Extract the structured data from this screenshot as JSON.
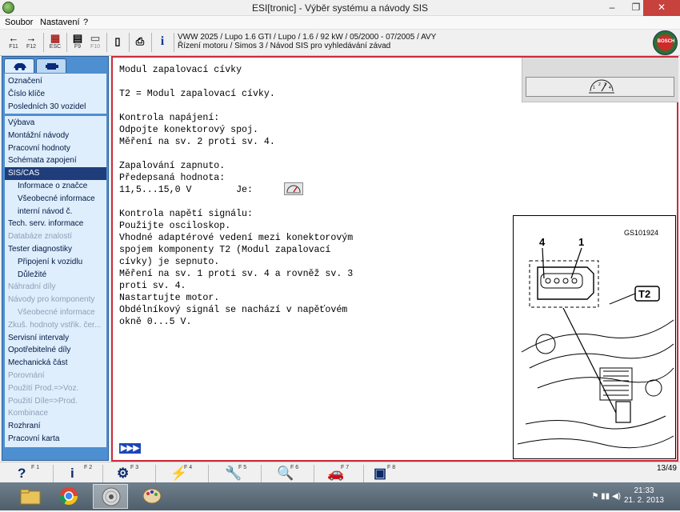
{
  "window": {
    "title": "ESI[tronic] - Výběr systému a návody SIS",
    "controls": {
      "minimize": "–",
      "maximize": "❐",
      "close": "✕"
    }
  },
  "menu": {
    "items": [
      "Soubor",
      "Nastavení",
      "?"
    ]
  },
  "toolbar": {
    "buttons": [
      {
        "glyph": "←",
        "key": "F11"
      },
      {
        "glyph": "→",
        "key": "F12"
      },
      {
        "glyph": "▦",
        "key": "ESC"
      },
      {
        "glyph": "▤",
        "key": "F9"
      },
      {
        "glyph": "▭",
        "key": "F10"
      },
      {
        "glyph": "▯",
        "key": ""
      },
      {
        "glyph": "⎙",
        "key": ""
      },
      {
        "glyph": "i",
        "key": ""
      }
    ],
    "vehicle_line1": "VWW 2025 / Lupo 1.6 GTI / Lupo / 1.6 / 92 kW / 05/2000 - 07/2005 / AVY",
    "vehicle_line2": "Řízení motoru / Simos 3 / Návod SIS pro vyhledávání závad",
    "logo_text": "BOSCH"
  },
  "sidebar": {
    "group1": [
      "Označení",
      "Číslo klíče",
      "Posledních 30 vozidel"
    ],
    "group2": [
      {
        "label": "Výbava",
        "type": "normal"
      },
      {
        "label": "Montážní návody",
        "type": "normal"
      },
      {
        "label": "Pracovní hodnoty",
        "type": "normal"
      },
      {
        "label": "Schémata zapojení",
        "type": "normal"
      },
      {
        "label": "SIS/CAS",
        "type": "selected"
      },
      {
        "label": "Informace o značce",
        "type": "sub"
      },
      {
        "label": "Všeobecné informace",
        "type": "sub"
      },
      {
        "label": "interní návod č.",
        "type": "sub"
      },
      {
        "label": "Tech. serv. informace",
        "type": "normal"
      },
      {
        "label": "Databáze znalostí",
        "type": "disabled"
      },
      {
        "label": "Tester diagnostiky",
        "type": "normal"
      },
      {
        "label": "Připojení k vozidlu",
        "type": "sub"
      },
      {
        "label": "Důležité",
        "type": "sub"
      },
      {
        "label": "Náhradní díly",
        "type": "disabled"
      },
      {
        "label": "Návody pro komponenty",
        "type": "disabled"
      },
      {
        "label": "Všeobecné informace",
        "type": "sub-disabled"
      },
      {
        "label": "Zkuš. hodnoty vstřik. čer...",
        "type": "disabled"
      },
      {
        "label": "Servisní intervaly",
        "type": "normal"
      },
      {
        "label": "Opotřebitelné díly",
        "type": "normal"
      },
      {
        "label": "Mechanická část",
        "type": "normal"
      },
      {
        "label": "Porovnání",
        "type": "disabled"
      },
      {
        "label": "Použití Prod.=>Voz.",
        "type": "disabled"
      },
      {
        "label": "Použití Díle=>Prod.",
        "type": "disabled"
      },
      {
        "label": "Kombinace",
        "type": "disabled"
      },
      {
        "label": "Rozhraní",
        "type": "normal"
      },
      {
        "label": "Pracovní karta",
        "type": "normal"
      }
    ]
  },
  "content": {
    "text_lines": [
      "Modul zapalovací cívky",
      "",
      "T2 = Modul zapalovací cívky.",
      "",
      "Kontrola napájení:",
      "Odpojte konektorový spoj.",
      "Měření na sv. 2 proti sv. 4.",
      "",
      "Zapalování zapnuto.",
      "Předepsaná hodnota:",
      "11,5...15,0 V        Je:      V",
      "",
      "Kontrola napětí signálu:",
      "Použijte osciloskop.",
      "Vhodné adaptérové vedení mezi konektorovým",
      "spojem komponenty T2 (Modul zapalovací",
      "cívky) je sepnuto.",
      "Měření na sv. 1 proti sv. 4 a rovněž sv. 3",
      "proti sv. 4.",
      "Nastartujte motor.",
      "Obdélníkový signál se nachází v napěťovém",
      "okně 0...5 V."
    ],
    "next_label": "▶▶▶",
    "diagram": {
      "code": "GS101924",
      "pin4": "4",
      "pin1": "1",
      "component": "T2"
    }
  },
  "statusbar": {
    "keys": [
      {
        "glyph": "?",
        "key": "F 1"
      },
      {
        "glyph": "i",
        "key": "F 2"
      },
      {
        "glyph": "⚙",
        "key": "F 3"
      },
      {
        "glyph": "⚡",
        "key": "F 4"
      },
      {
        "glyph": "🔧",
        "key": "F 5"
      },
      {
        "glyph": "🔍",
        "key": "F 6"
      },
      {
        "glyph": "🚗",
        "key": "F 7"
      },
      {
        "glyph": "▣",
        "key": "F 8"
      }
    ],
    "page": "13/49"
  },
  "taskbar": {
    "time": "21:33",
    "date": "21. 2. 2013"
  }
}
